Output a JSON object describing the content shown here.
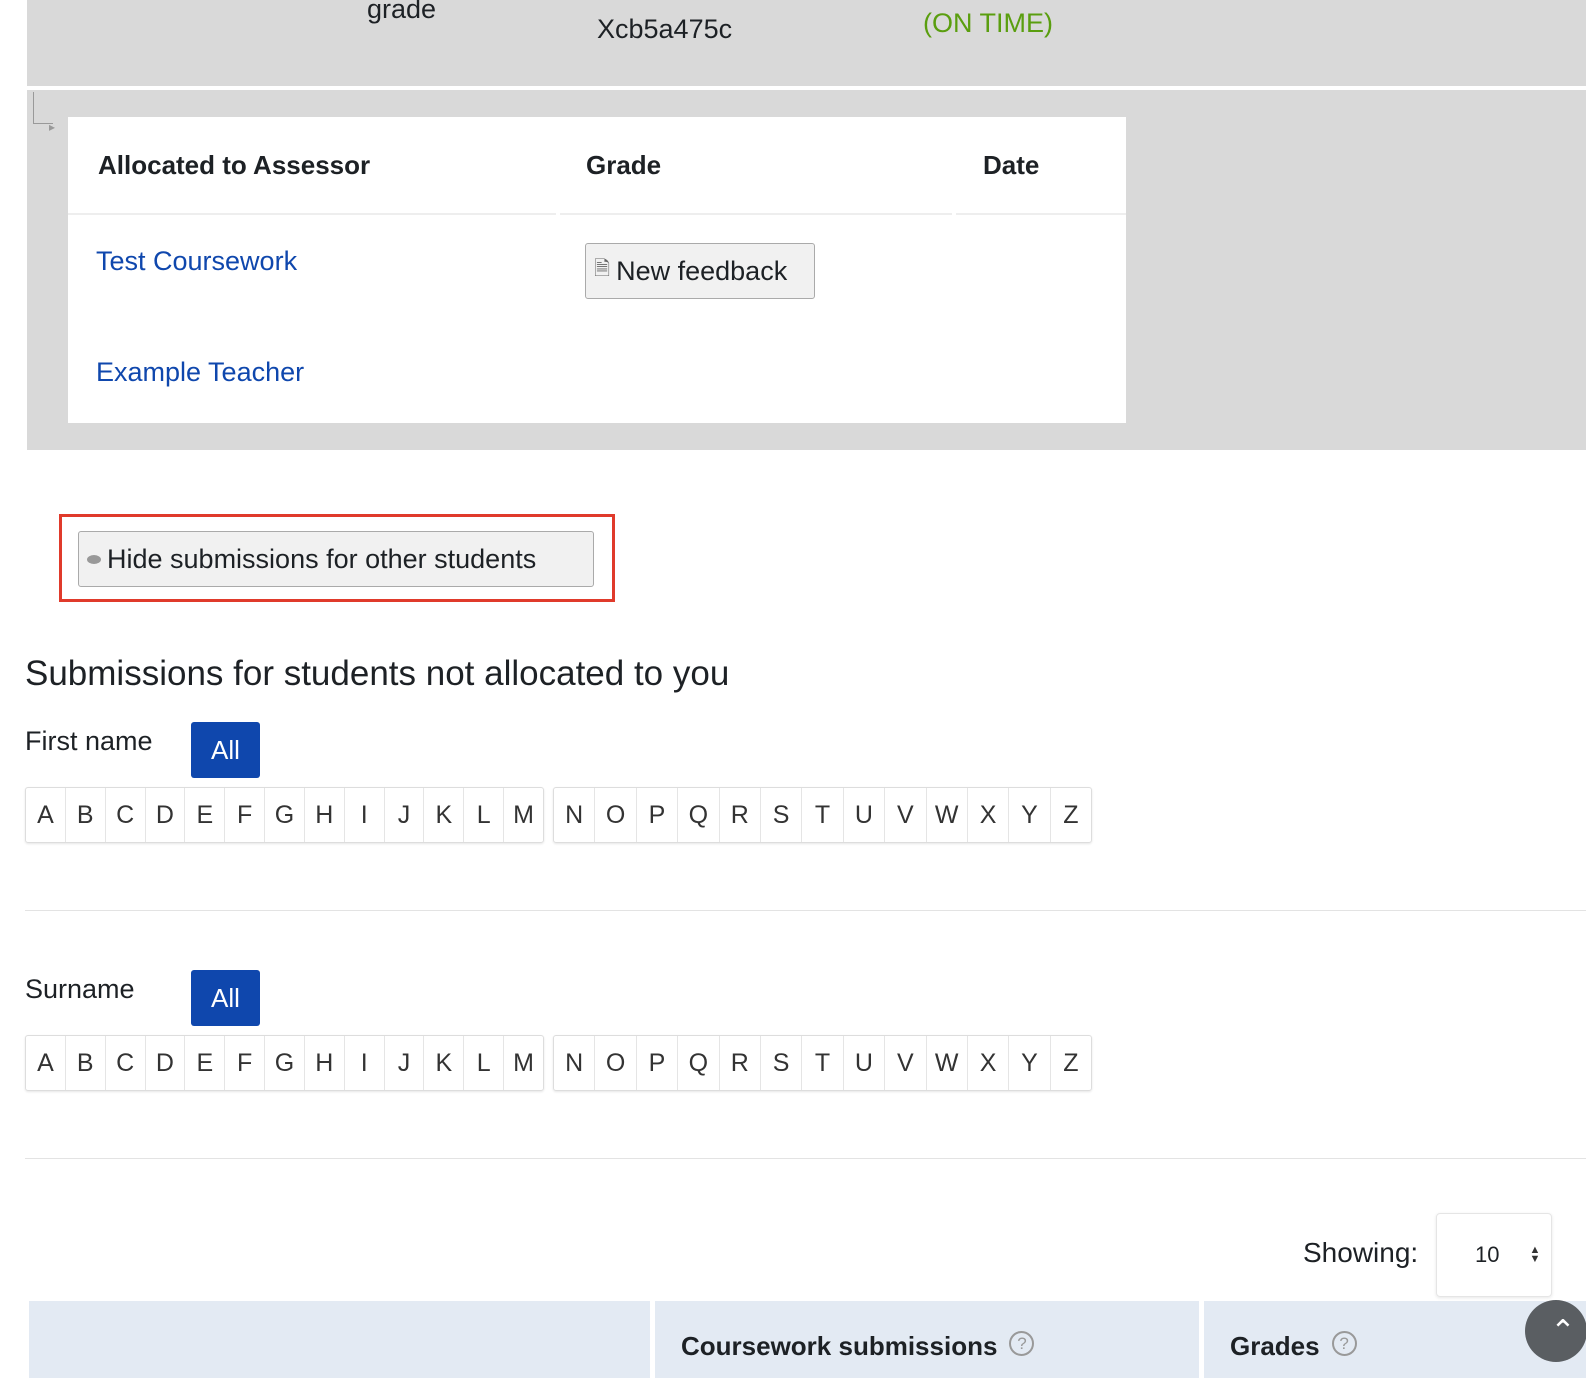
{
  "top_row": {
    "grade_label": "grade",
    "submission_id": "Xcb5a475c",
    "status": "(ON TIME)"
  },
  "allocation_table": {
    "headers": [
      "Allocated to Assessor",
      "Grade",
      "Date"
    ],
    "rows": [
      {
        "assessor": "Test Coursework",
        "grade_button": "New feedback"
      },
      {
        "assessor": "Example Teacher"
      }
    ]
  },
  "hide_button": "Hide submissions for other students",
  "heading": "Submissions for students not allocated to you",
  "first_name": {
    "label": "First name",
    "all": "All"
  },
  "surname": {
    "label": "Surname",
    "all": "All"
  },
  "letters": [
    "A",
    "B",
    "C",
    "D",
    "E",
    "F",
    "G",
    "H",
    "I",
    "J",
    "K",
    "L",
    "M",
    "N",
    "O",
    "P",
    "Q",
    "R",
    "S",
    "T",
    "U",
    "V",
    "W",
    "X",
    "Y",
    "Z"
  ],
  "showing": {
    "label": "Showing:",
    "value": "10"
  },
  "table_headers": [
    "",
    "Coursework submissions",
    "Grades"
  ],
  "colors": {
    "accent": "#0f47ad",
    "on_time": "#5a9e0f",
    "highlight": "#e03a2b"
  }
}
